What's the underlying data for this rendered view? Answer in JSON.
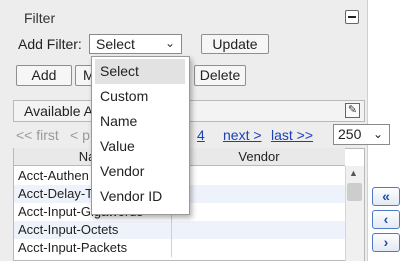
{
  "filter": {
    "title": "Filter",
    "add_filter_label": "Add Filter:",
    "select_value": "Select",
    "update_label": "Update",
    "collapse_icon": "minus-icon",
    "dropdown_options": [
      "Select",
      "Custom",
      "Name",
      "Value",
      "Vendor",
      "Vendor ID"
    ],
    "selected_option": "Select"
  },
  "actions": {
    "add_label": "Add",
    "m_label": "M",
    "delete_label": "Delete"
  },
  "available": {
    "title": "Available A",
    "settings_icon": "wrench-icon",
    "pager": {
      "first": "<< first",
      "prev": "< p",
      "page": "4",
      "next": "next >",
      "last": "last >>",
      "per_page": "250"
    },
    "columns": {
      "name": "Nam",
      "vendor": "Vendor"
    },
    "rows": [
      {
        "name": "Acct-Authen",
        "vendor": ""
      },
      {
        "name": "Acct-Delay-T",
        "vendor": ""
      },
      {
        "name": "Acct-Input-Gigawords",
        "vendor": ""
      },
      {
        "name": "Acct-Input-Octets",
        "vendor": ""
      },
      {
        "name": "Acct-Input-Packets",
        "vendor": ""
      }
    ]
  },
  "side_buttons": [
    "double-chevron-left-icon",
    "chevron-left-icon",
    "chevron-right-icon"
  ],
  "colors": {
    "link": "#1a3fb8",
    "side_button": "#1e4ea8",
    "panel": "#ededed"
  }
}
